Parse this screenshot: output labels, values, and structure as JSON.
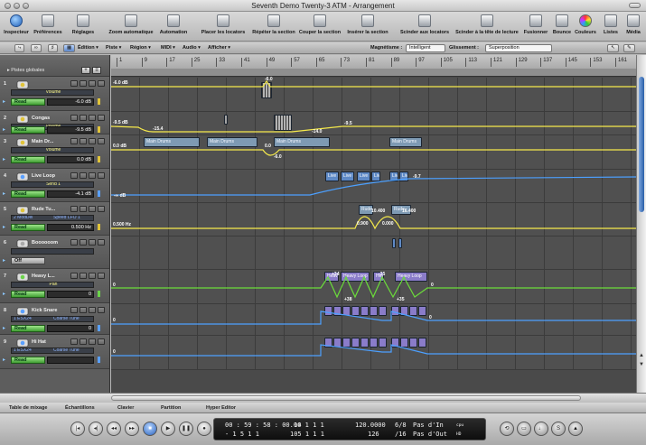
{
  "window": {
    "title": "Seventh Demo Twenty-3 ATM - Arrangement"
  },
  "toolbar": {
    "items": [
      {
        "label": "Inspecteur",
        "icon": "info-icon"
      },
      {
        "label": "Préférences",
        "icon": "preferences-icon"
      },
      {
        "label": "Réglages",
        "icon": "settings-icon"
      },
      {
        "label": "Zoom automatique",
        "icon": "zoom-icon"
      },
      {
        "label": "Automation",
        "icon": "automation-icon"
      },
      {
        "label": "Placer les locators",
        "icon": "locators-icon"
      },
      {
        "label": "Répéter la section",
        "icon": "repeat-section-icon"
      },
      {
        "label": "Couper la section",
        "icon": "cut-section-icon"
      },
      {
        "label": "Insérer la section",
        "icon": "insert-section-icon"
      },
      {
        "label": "Scinder aux locators",
        "icon": "split-locators-icon"
      },
      {
        "label": "Scinder à la tête de lecture",
        "icon": "split-playhead-icon"
      },
      {
        "label": "Fusionner",
        "icon": "merge-icon"
      },
      {
        "label": "Bounce",
        "icon": "bounce-icon"
      },
      {
        "label": "Couleurs",
        "icon": "colors-icon"
      },
      {
        "label": "Listes",
        "icon": "lists-icon"
      },
      {
        "label": "Média",
        "icon": "media-icon"
      }
    ]
  },
  "arrbar": {
    "edit_menu": "Édition ▾",
    "track_menu": "Piste ▾",
    "region_menu": "Région ▾",
    "midi_menu": "MIDI ▾",
    "audio_menu": "Audio ▾",
    "view_menu": "Afficher ▾",
    "snap_label": "Magnétisme :",
    "snap_value": "Intelligent",
    "drag_label": "Glissement :",
    "drag_value": "Superposition"
  },
  "global_tracks": {
    "label": "▸ Pistes globales"
  },
  "tracks": [
    {
      "num": "1",
      "name": "",
      "param": "Volume",
      "mode": "Read",
      "value": "-6.0 dB",
      "color": "#e1c43a"
    },
    {
      "num": "2",
      "name": "Congas",
      "param": "Volume",
      "mode": "Read",
      "value": "-9.5 dB",
      "color": "#e1c43a"
    },
    {
      "num": "3",
      "name": "Main Dr...",
      "param": "Volume",
      "mode": "Read",
      "value": "0.0 dB",
      "color": "#e1c43a"
    },
    {
      "num": "4",
      "name": "Live Loop",
      "param": "Send 1",
      "mode": "Read",
      "value": "-4.1 dB",
      "color": "#5aa0ff"
    },
    {
      "num": "5",
      "name": "Rude Tu...",
      "param": "2 ModDel",
      "param2": "Speed LFO 1",
      "mode": "Read",
      "value": "0.500 Hz",
      "color": "#e1c43a"
    },
    {
      "num": "6",
      "name": "Boooooom",
      "param": "",
      "mode": "Off",
      "value": "",
      "color": "#aaaaaa"
    },
    {
      "num": "7",
      "name": "Heavy L...",
      "param": "Pan",
      "mode": "Read",
      "value": "0",
      "color": "#6bd34a"
    },
    {
      "num": "8",
      "name": "Kick Snare",
      "param": "1 ESX24",
      "param2": "Coarse Tune",
      "mode": "Read",
      "value": "0",
      "color": "#5aa0ff"
    },
    {
      "num": "9",
      "name": "Hi Hat",
      "param": "1 ESX24",
      "param2": "Coarse Tune",
      "mode": "Read",
      "value": "",
      "color": "#5aa0ff"
    }
  ],
  "ruler": {
    "marks": [
      "1",
      "9",
      "17",
      "25",
      "33",
      "41",
      "49",
      "57",
      "65",
      "73",
      "81",
      "89",
      "97",
      "105",
      "113",
      "121",
      "129",
      "137",
      "145",
      "153",
      "161"
    ]
  },
  "regions": {
    "main_drums": "Main Drums",
    "live_loop": "Live L",
    "rude": "Rude",
    "heavy": "Heavy Loop"
  },
  "automation_labels": {
    "t1_start": "-6.0 dB",
    "t1_peak": "-6.0",
    "t2_start": "-9.5 dB",
    "t2_a": "-15.4",
    "t2_b": "-14.0",
    "t2_c": "-9.5",
    "t3_start": "0.0 dB",
    "t3_a": "0.0",
    "t3_b": "-6.0",
    "t4_start": "-∞ dB",
    "t4_end": "-9.7",
    "t5_start": "0.500 Hz",
    "t5_a": "10.400",
    "t5_b": "16.400",
    "t5_c": "0.900",
    "t5_d": "0.000",
    "t7_start": "0",
    "t7_a": "+34",
    "t7_b": "-35",
    "t7_c": "+38",
    "t7_d": "+35",
    "t7_e": "0",
    "t8_start": "0",
    "t8_end": "0",
    "t9_start": "0"
  },
  "tabs": [
    "Table de mixage",
    "Échantillons",
    "Clavier",
    "Partition",
    "Hyper Editor"
  ],
  "transport": {
    "time": "00 : 59 : 58 : 00.00",
    "time_bottom": "-   1   5   1     1",
    "bars": "14   1   1     1",
    "bars_bottom": "105   1   1     1",
    "tempo": "120.0000",
    "tempo_bottom": "126",
    "signature": "6/8",
    "division": "/16",
    "in_label": "Pas d'In",
    "out_label": "Pas d'Out",
    "cpu": "cpu",
    "hd": "HD"
  }
}
